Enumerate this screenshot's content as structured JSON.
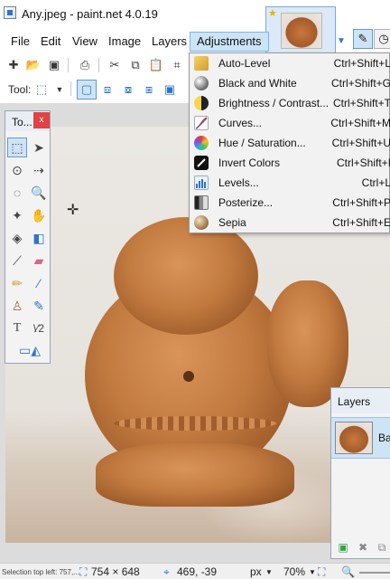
{
  "window": {
    "title": "Any.jpeg - paint.net 4.0.19"
  },
  "menubar": {
    "items": [
      "File",
      "Edit",
      "View",
      "Image",
      "Layers",
      "Adjustments"
    ],
    "active": "Adjustments"
  },
  "toolbar": {
    "tool_label": "Tool:"
  },
  "tools_window": {
    "title": "To...",
    "close_label": "x"
  },
  "adjustments_menu": {
    "items": [
      {
        "label": "Auto-Level",
        "shortcut": "Ctrl+Shift+L",
        "icon": "auto-level-icon"
      },
      {
        "label": "Black and White",
        "shortcut": "Ctrl+Shift+G",
        "icon": "black-and-white-icon"
      },
      {
        "label": "Brightness / Contrast...",
        "shortcut": "Ctrl+Shift+T",
        "icon": "brightness-contrast-icon"
      },
      {
        "label": "Curves...",
        "shortcut": "Ctrl+Shift+M",
        "icon": "curves-icon"
      },
      {
        "label": "Hue / Saturation...",
        "shortcut": "Ctrl+Shift+U",
        "icon": "hue-saturation-icon"
      },
      {
        "label": "Invert Colors",
        "shortcut": "Ctrl+Shift+I",
        "icon": "invert-colors-icon"
      },
      {
        "label": "Levels...",
        "shortcut": "Ctrl+L",
        "icon": "levels-icon"
      },
      {
        "label": "Posterize...",
        "shortcut": "Ctrl+Shift+P",
        "icon": "posterize-icon"
      },
      {
        "label": "Sepia",
        "shortcut": "Ctrl+Shift+E",
        "icon": "sepia-icon"
      }
    ]
  },
  "layers_window": {
    "title": "Layers",
    "layer_name": "Ba"
  },
  "statusbar": {
    "selection_info": "Selection top left: 757,...",
    "image_size": "754 × 648",
    "cursor_position": "469, -39",
    "units": "px",
    "zoom": "70%"
  },
  "colors": {
    "accent": "#5b9bd5",
    "active_fill": "#cfe3f7",
    "close_red": "#e04343"
  }
}
